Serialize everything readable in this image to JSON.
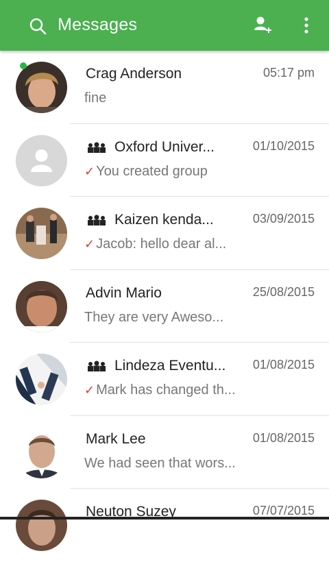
{
  "appbar": {
    "title": "Messages",
    "icons": [
      "search-icon",
      "add-contact-icon",
      "more-vert-icon"
    ],
    "color": "#4caf50"
  },
  "chats": [
    {
      "name": "Crag Anderson",
      "time": "05:17 pm",
      "preview": "fine",
      "group": false,
      "sent": false,
      "online": true
    },
    {
      "name": "Oxford Univer...",
      "time": "01/10/2015",
      "preview": "You  created group",
      "group": true,
      "sent": true,
      "online": false
    },
    {
      "name": "Kaizen kenda...",
      "time": "03/09/2015",
      "preview": "Jacob: hello dear al...",
      "group": true,
      "sent": true,
      "online": false
    },
    {
      "name": "Advin Mario",
      "time": "25/08/2015",
      "preview": "They are very Aweso...",
      "group": false,
      "sent": false,
      "online": false
    },
    {
      "name": "Lindeza Eventu...",
      "time": "01/08/2015",
      "preview": "Mark has changed th...",
      "group": true,
      "sent": true,
      "online": false
    },
    {
      "name": "Mark Lee",
      "time": "01/08/2015",
      "preview": "We had seen that wors...",
      "group": false,
      "sent": false,
      "online": false
    },
    {
      "name": "Neuton Suzey",
      "time": "07/07/2015",
      "preview": "",
      "group": false,
      "sent": false,
      "online": false
    }
  ]
}
